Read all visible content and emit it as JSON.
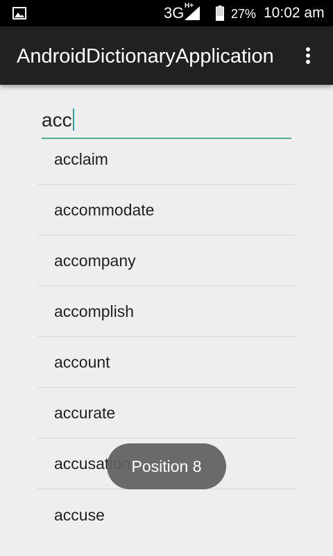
{
  "status_bar": {
    "network": "3G",
    "network_sub": "H+",
    "battery": "27%",
    "time": "10:02 am",
    "icons": [
      "gallery-icon",
      "signal-icon",
      "battery-icon"
    ]
  },
  "app_bar": {
    "title": "AndroidDictionaryApplication",
    "menu_icon": "overflow-menu-icon"
  },
  "search": {
    "value": "acc"
  },
  "suggestions": [
    "acclaim",
    "accommodate",
    "accompany",
    "accomplish",
    "account",
    "accurate",
    "accusation",
    "accuse"
  ],
  "toast": {
    "text": "Position 8"
  },
  "colors": {
    "accent": "#26a69a",
    "app_bar": "#212121",
    "background": "#eeeeee"
  }
}
